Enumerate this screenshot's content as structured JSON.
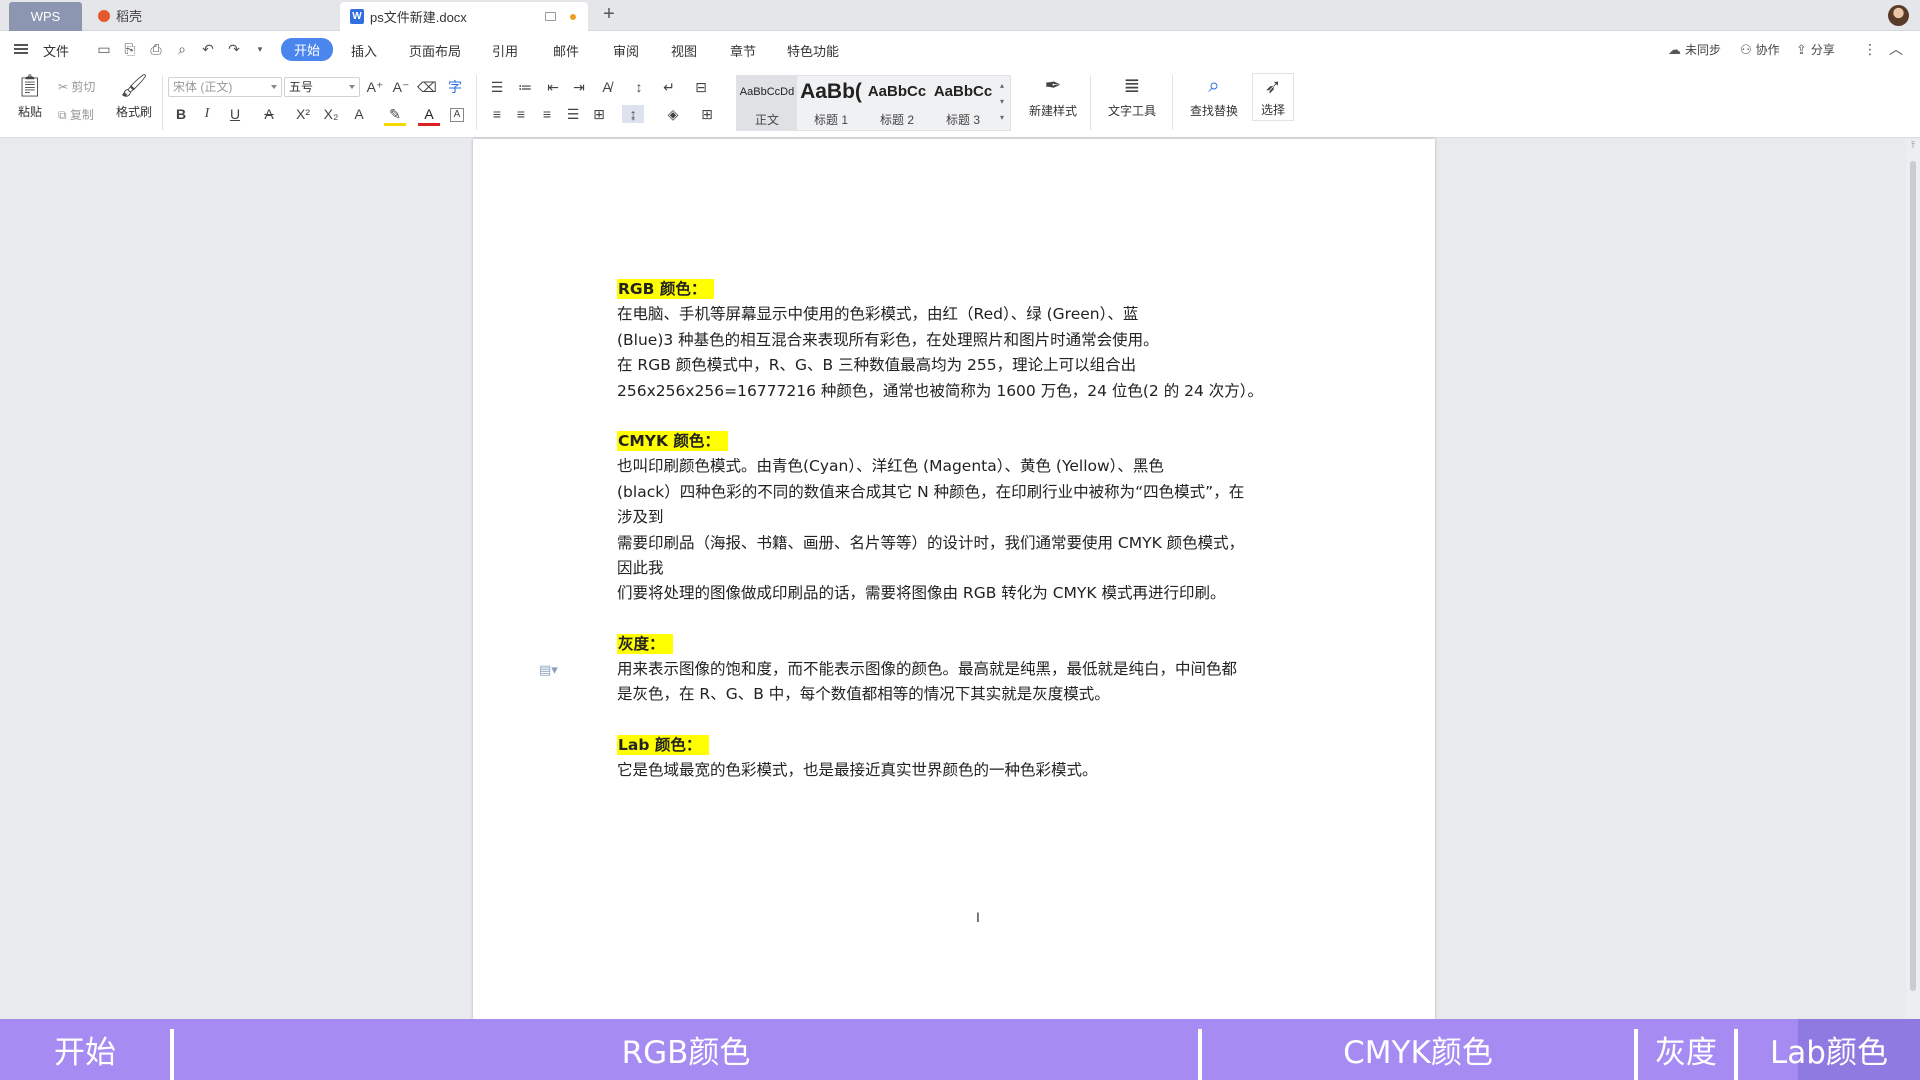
{
  "tabs": {
    "wps": "WPS",
    "daoke": "稻壳",
    "doc": "ps文件新建.docx"
  },
  "menu": {
    "file": "文件",
    "items": [
      "开始",
      "插入",
      "页面布局",
      "引用",
      "邮件",
      "审阅",
      "视图",
      "章节",
      "特色功能"
    ],
    "right": {
      "sync": "未同步",
      "collab": "协作",
      "share": "分享"
    }
  },
  "ribbon": {
    "paste": "粘贴",
    "cut": "剪切",
    "copy": "复制",
    "format_painter": "格式刷",
    "font_name": "宋体 (正文)",
    "font_size": "五号",
    "styles": [
      {
        "preview": "AaBbCcDd",
        "label": "正文"
      },
      {
        "preview": "AaBb(",
        "label": "标题 1"
      },
      {
        "preview": "AaBbCc",
        "label": "标题 2"
      },
      {
        "preview": "AaBbCc",
        "label": "标题 3"
      }
    ],
    "new_style": "新建样式",
    "text_tools": "文字工具",
    "find_replace": "查找替换",
    "select": "选择"
  },
  "document": {
    "sections": [
      {
        "heading": "RGB 颜色：",
        "lines": [
          "在电脑、手机等屏幕显示中使用的色彩模式，由红（Red）、绿 (Green）、蓝",
          "(Blue)3 种基色的相互混合来表现所有彩色，在处理照片和图片时通常会使用。",
          "在 RGB 颜色模式中，R、G、B 三种数值最高均为 255，理论上可以组合出",
          "256x256x256=16777216 种颜色，通常也被简称为 1600 万色，24 位色(2 的 24 次方）。"
        ]
      },
      {
        "heading": "CMYK 颜色：",
        "lines": [
          "也叫印刷颜色模式。由青色(Cyan）、洋红色 (Magenta）、黄色 (Yellow）、黑色",
          "(black）四种色彩的不同的数值来合成其它 N 种颜色，在印刷行业中被称为“四色模式”，在",
          "涉及到",
          "需要印刷品（海报、书籍、画册、名片等等）的设计时，我们通常要使用 CMYK 颜色模式，",
          "因此我",
          "们要将处理的图像做成印刷品的话，需要将图像由 RGB 转化为 CMYK 模式再进行印刷。"
        ]
      },
      {
        "heading": "灰度：",
        "lines": [
          "用来表示图像的饱和度，而不能表示图像的颜色。最高就是纯黑，最低就是纯白，中间色都",
          "是灰色，在 R、G、B 中，每个数值都相等的情况下其实就是灰度模式。"
        ]
      },
      {
        "heading": "Lab 颜色：",
        "lines": [
          "它是色域最宽的色彩模式，也是最接近真实世界颜色的一种色彩模式。"
        ]
      }
    ]
  },
  "chapters": [
    "开始",
    "RGB颜色",
    "CMYK颜色",
    "灰度",
    "Lab颜色"
  ],
  "colors": {
    "accent": "#4a86ee",
    "highlight": "#ffff00",
    "chapter_bar": "#a58bf2"
  }
}
